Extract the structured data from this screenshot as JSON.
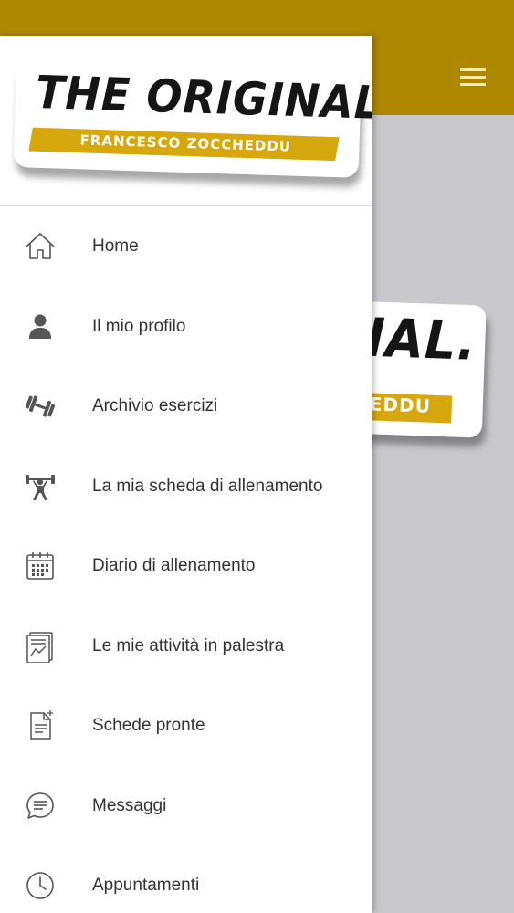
{
  "brand": {
    "title": "THE ORIGINAL.",
    "subtitle": "FRANCESCO ZOCCHEDDU",
    "accent_color": "#ad8700",
    "band_color": "#d7a70e"
  },
  "appbar": {
    "menu_icon": "hamburger-icon"
  },
  "background_logo": {
    "visible_title": "IAL.",
    "visible_subtitle": "EDDU"
  },
  "menu": {
    "items": [
      {
        "label": "Home",
        "icon": "home-icon"
      },
      {
        "label": "Il mio profilo",
        "icon": "user-icon"
      },
      {
        "label": "Archivio esercizi",
        "icon": "dumbbell-icon"
      },
      {
        "label": "La mia scheda di allenamento",
        "icon": "weightlifter-icon"
      },
      {
        "label": "Diario di allenamento",
        "icon": "calendar-icon"
      },
      {
        "label": "Le mie attività in palestra",
        "icon": "activity-report-icon"
      },
      {
        "label": "Schede pronte",
        "icon": "document-icon"
      },
      {
        "label": "Messaggi",
        "icon": "message-icon"
      },
      {
        "label": "Appuntamenti",
        "icon": "clock-icon"
      }
    ]
  }
}
